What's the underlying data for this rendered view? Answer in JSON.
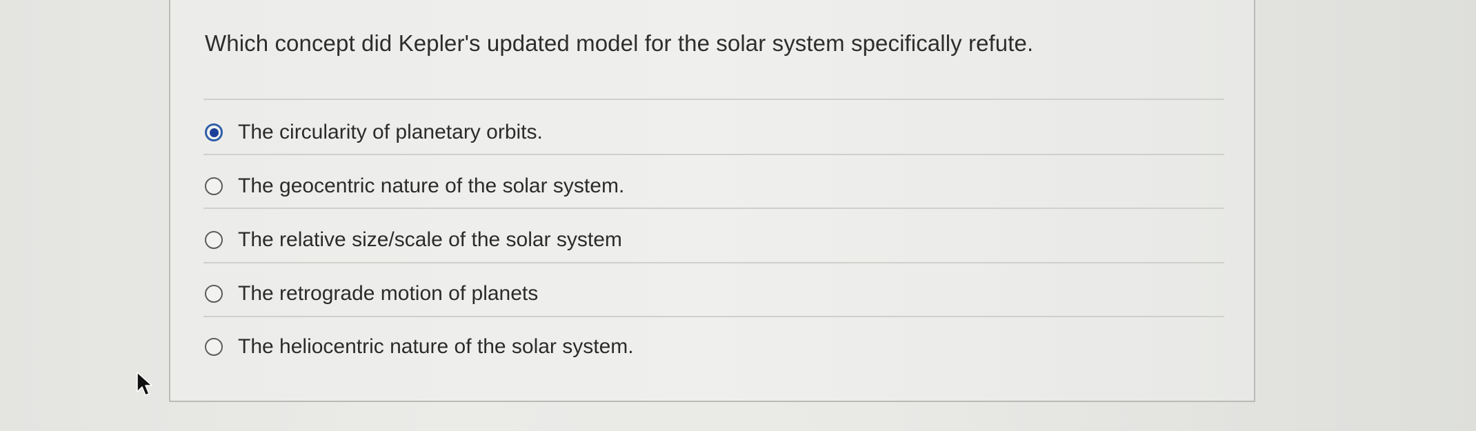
{
  "question": {
    "text": "Which concept did Kepler's updated model for the solar system specifically refute."
  },
  "options": [
    {
      "label": "The circularity of planetary orbits.",
      "selected": true
    },
    {
      "label": "The geocentric nature of the solar system.",
      "selected": false
    },
    {
      "label": "The relative size/scale of the solar system",
      "selected": false
    },
    {
      "label": "The retrograde motion of planets",
      "selected": false
    },
    {
      "label": "The heliocentric nature of the solar system.",
      "selected": false
    }
  ],
  "colors": {
    "selected_radio": "#1d3f9a",
    "text": "#2b2b2b",
    "divider": "#cfd0cc"
  },
  "icons": {
    "cursor": "mouse-pointer-icon"
  }
}
